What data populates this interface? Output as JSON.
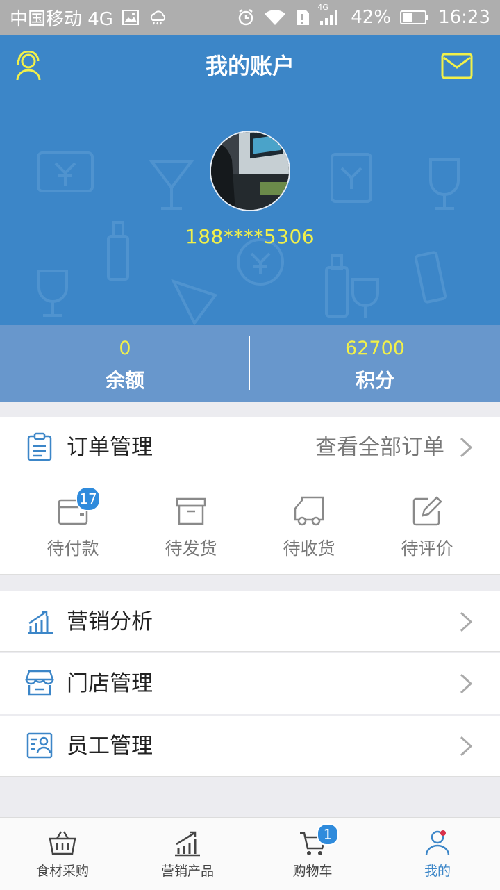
{
  "status_bar": {
    "carrier": "中国移动 4G",
    "network": "4G",
    "battery": "42%",
    "time": "16:23"
  },
  "header": {
    "title": "我的账户",
    "left_icon": "customer-service-icon",
    "right_icon": "mail-icon"
  },
  "profile": {
    "phone": "188****5306"
  },
  "stats": [
    {
      "value": "0",
      "label": "余额"
    },
    {
      "value": "62700",
      "label": "积分"
    }
  ],
  "orders": {
    "title": "订单管理",
    "view_all": "查看全部订单",
    "statuses": [
      {
        "label": "待付款",
        "badge": "17",
        "icon": "wallet-icon"
      },
      {
        "label": "待发货",
        "icon": "box-icon"
      },
      {
        "label": "待收货",
        "icon": "truck-icon"
      },
      {
        "label": "待评价",
        "icon": "edit-icon"
      }
    ]
  },
  "menu": [
    {
      "label": "营销分析",
      "icon": "chart-icon"
    },
    {
      "label": "门店管理",
      "icon": "store-icon"
    },
    {
      "label": "员工管理",
      "icon": "staff-icon"
    }
  ],
  "tabbar": [
    {
      "label": "食材采购",
      "icon": "basket-icon"
    },
    {
      "label": "营销产品",
      "icon": "bar-chart-icon"
    },
    {
      "label": "购物车",
      "icon": "cart-icon",
      "badge": "1"
    },
    {
      "label": "我的",
      "icon": "user-icon",
      "active": true
    }
  ],
  "colors": {
    "primary": "#3c86c8",
    "accent_yellow": "#f1f04a",
    "stats_bg": "#6897cc",
    "badge": "#2f8bdc"
  }
}
